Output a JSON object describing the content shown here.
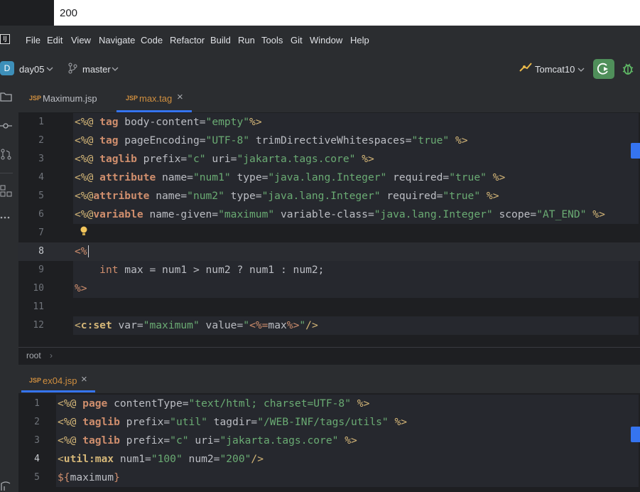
{
  "topbar": {
    "text": "200"
  },
  "menu": {
    "items": [
      "File",
      "Edit",
      "View",
      "Navigate",
      "Code",
      "Refactor",
      "Build",
      "Run",
      "Tools",
      "Git",
      "Window",
      "Help"
    ]
  },
  "toolbar": {
    "project_badge": "D",
    "project_name": "day05",
    "branch": "master",
    "run_config": "Tomcat10"
  },
  "tabs_top": [
    {
      "icon": "JSP",
      "label": "Maximum.jsp",
      "active": false
    },
    {
      "icon": "JSP",
      "label": "max.tag",
      "active": true,
      "close": "×"
    }
  ],
  "editor_top": {
    "line_numbers": [
      "1",
      "2",
      "3",
      "4",
      "5",
      "6",
      "7",
      "8",
      "9",
      "10",
      "11",
      "12"
    ],
    "lines": [
      [
        {
          "t": "<%@ ",
          "c": "dlm"
        },
        {
          "t": "tag",
          "c": "kw"
        },
        {
          "t": " body-content=",
          "c": "att"
        },
        {
          "t": "\"empty\"",
          "c": "str"
        },
        {
          "t": "%>",
          "c": "dlm"
        }
      ],
      [
        {
          "t": "<%@ ",
          "c": "dlm"
        },
        {
          "t": "tag",
          "c": "kw"
        },
        {
          "t": " pageEncoding=",
          "c": "att"
        },
        {
          "t": "\"UTF-8\"",
          "c": "str"
        },
        {
          "t": " trimDirectiveWhitespaces=",
          "c": "att"
        },
        {
          "t": "\"true\"",
          "c": "str"
        },
        {
          "t": " %>",
          "c": "dlm"
        }
      ],
      [
        {
          "t": "<%@ ",
          "c": "dlm"
        },
        {
          "t": "taglib",
          "c": "kw"
        },
        {
          "t": " prefix=",
          "c": "att"
        },
        {
          "t": "\"c\"",
          "c": "str"
        },
        {
          "t": " uri=",
          "c": "att"
        },
        {
          "t": "\"jakarta.tags.core\"",
          "c": "str"
        },
        {
          "t": " %>",
          "c": "dlm"
        }
      ],
      [
        {
          "t": "<%@ ",
          "c": "dlm"
        },
        {
          "t": "attribute",
          "c": "kw"
        },
        {
          "t": " name=",
          "c": "att"
        },
        {
          "t": "\"num1\"",
          "c": "str"
        },
        {
          "t": " type=",
          "c": "att"
        },
        {
          "t": "\"java.lang.Integer\"",
          "c": "str"
        },
        {
          "t": " required=",
          "c": "att"
        },
        {
          "t": "\"true\"",
          "c": "str"
        },
        {
          "t": " %>",
          "c": "dlm"
        }
      ],
      [
        {
          "t": "<%@",
          "c": "dlm"
        },
        {
          "t": "attribute",
          "c": "kw"
        },
        {
          "t": " name=",
          "c": "att"
        },
        {
          "t": "\"num2\"",
          "c": "str"
        },
        {
          "t": " type=",
          "c": "att"
        },
        {
          "t": "\"java.lang.Integer\"",
          "c": "str"
        },
        {
          "t": " required=",
          "c": "att"
        },
        {
          "t": "\"true\"",
          "c": "str"
        },
        {
          "t": " %>",
          "c": "dlm"
        }
      ],
      [
        {
          "t": "<%@",
          "c": "dlm"
        },
        {
          "t": "variable",
          "c": "kw"
        },
        {
          "t": " name-given=",
          "c": "att"
        },
        {
          "t": "\"maximum\"",
          "c": "str"
        },
        {
          "t": " variable-class=",
          "c": "att"
        },
        {
          "t": "\"java.lang.Integer\"",
          "c": "str"
        },
        {
          "t": " scope=",
          "c": "att"
        },
        {
          "t": "\"AT_END\"",
          "c": "str"
        },
        {
          "t": " %>",
          "c": "dlm"
        }
      ],
      [],
      [
        {
          "t": "<%",
          "c": "pct"
        }
      ],
      [
        {
          "t": "    ",
          "c": "att"
        },
        {
          "t": "int",
          "c": "type"
        },
        {
          "t": " max = num1 > num2 ? num1 : num2;",
          "c": "att"
        }
      ],
      [
        {
          "t": "%>",
          "c": "pct"
        }
      ],
      [],
      [
        {
          "t": "<",
          "c": "dlm"
        },
        {
          "t": "c:set",
          "c": "tag"
        },
        {
          "t": " var=",
          "c": "att"
        },
        {
          "t": "\"maximum\"",
          "c": "str"
        },
        {
          "t": " value=",
          "c": "att"
        },
        {
          "t": "\"",
          "c": "str"
        },
        {
          "t": "<%=",
          "c": "pct"
        },
        {
          "t": "max",
          "c": "att"
        },
        {
          "t": "%>",
          "c": "pct"
        },
        {
          "t": "\"",
          "c": "str"
        },
        {
          "t": "/>",
          "c": "dlm"
        }
      ]
    ]
  },
  "breadcrumb": {
    "root": "root",
    "sep": "›"
  },
  "tabs_bottom": [
    {
      "icon": "JSP",
      "label": "ex04.jsp",
      "active": true,
      "close": "×"
    }
  ],
  "editor_bottom": {
    "line_numbers": [
      "1",
      "2",
      "3",
      "4",
      "5"
    ],
    "lines": [
      [
        {
          "t": "<%@ ",
          "c": "dlm"
        },
        {
          "t": "page",
          "c": "kw"
        },
        {
          "t": " contentType=",
          "c": "att"
        },
        {
          "t": "\"text/html; charset=UTF-8\"",
          "c": "str"
        },
        {
          "t": " %>",
          "c": "dlm"
        }
      ],
      [
        {
          "t": "<%@ ",
          "c": "dlm"
        },
        {
          "t": "taglib",
          "c": "kw"
        },
        {
          "t": " prefix=",
          "c": "att"
        },
        {
          "t": "\"util\"",
          "c": "str"
        },
        {
          "t": " tagdir=",
          "c": "att"
        },
        {
          "t": "\"/WEB-INF/tags/utils\"",
          "c": "str"
        },
        {
          "t": " %>",
          "c": "dlm"
        }
      ],
      [
        {
          "t": "<%@ ",
          "c": "dlm"
        },
        {
          "t": "taglib",
          "c": "kw"
        },
        {
          "t": " prefix=",
          "c": "att"
        },
        {
          "t": "\"c\"",
          "c": "str"
        },
        {
          "t": " uri=",
          "c": "att"
        },
        {
          "t": "\"jakarta.tags.core\"",
          "c": "str"
        },
        {
          "t": " %>",
          "c": "dlm"
        }
      ],
      [
        {
          "t": "<",
          "c": "dlm"
        },
        {
          "t": "util:max",
          "c": "tag"
        },
        {
          "t": " num1=",
          "c": "att"
        },
        {
          "t": "\"100\"",
          "c": "str"
        },
        {
          "t": " num2=",
          "c": "att"
        },
        {
          "t": "\"200\"",
          "c": "str"
        },
        {
          "t": "/>",
          "c": "dlm"
        }
      ],
      [
        {
          "t": "${",
          "c": "pct"
        },
        {
          "t": "maximum",
          "c": "att"
        },
        {
          "t": "}",
          "c": "pct"
        }
      ]
    ]
  },
  "colors": {
    "accent": "#3574f0",
    "run_green": "#4f8f5a",
    "string": "#6aab73",
    "keyword": "#cf8e6d",
    "tag": "#d5b778"
  }
}
